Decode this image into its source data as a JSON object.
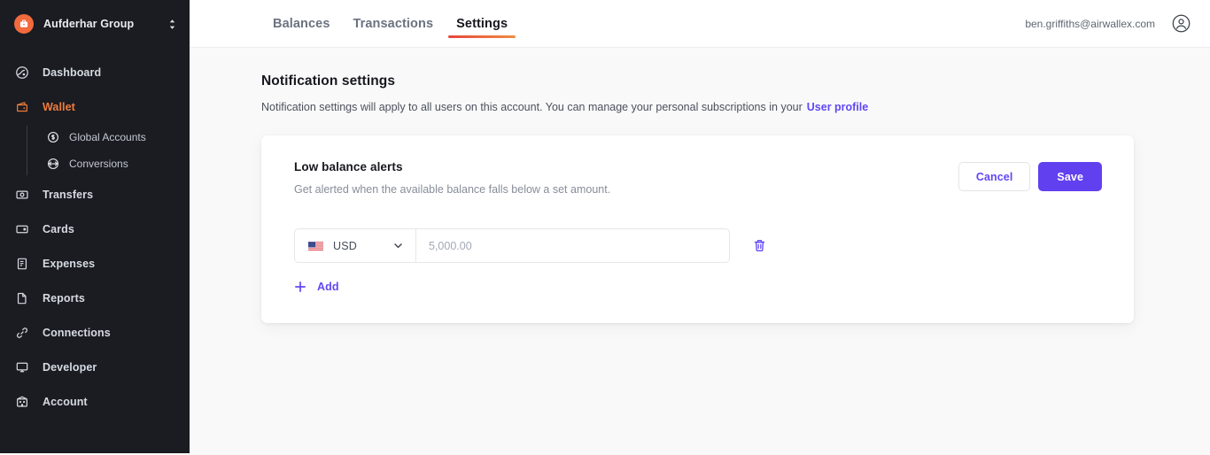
{
  "sidebar": {
    "org": {
      "name": "Aufderhar Group",
      "logo_icon": "briefcase-icon",
      "switch_icon": "chevron-up-down-icon",
      "logo_color": "#f26a3d"
    },
    "items": [
      {
        "label": "Dashboard",
        "icon": "dashboard-globe-icon",
        "active": false
      },
      {
        "label": "Wallet",
        "icon": "wallet-icon",
        "active": true
      },
      {
        "label": "Transfers",
        "icon": "transfers-icon",
        "active": false
      },
      {
        "label": "Cards",
        "icon": "card-icon",
        "active": false
      },
      {
        "label": "Expenses",
        "icon": "expenses-receipt-icon",
        "active": false
      },
      {
        "label": "Reports",
        "icon": "reports-document-icon",
        "active": false
      },
      {
        "label": "Connections",
        "icon": "link-icon",
        "active": false
      },
      {
        "label": "Developer",
        "icon": "monitor-icon",
        "active": false
      },
      {
        "label": "Account",
        "icon": "bank-building-icon",
        "active": false
      }
    ],
    "subitems": [
      {
        "label": "Global Accounts",
        "icon": "dollar-circle-icon"
      },
      {
        "label": "Conversions",
        "icon": "refresh-circle-icon"
      }
    ],
    "active_color": "#ef7c3c",
    "background": "#1a1c21"
  },
  "header": {
    "tabs": [
      {
        "label": "Balances",
        "active": false
      },
      {
        "label": "Transactions",
        "active": false
      },
      {
        "label": "Settings",
        "active": true
      }
    ],
    "user_email": "ben.griffiths@airwallex.com",
    "avatar_icon": "user-circle-icon",
    "active_tab_gradient_from": "#e5453c",
    "active_tab_gradient_to": "#ef8d44"
  },
  "page": {
    "title": "Notification settings",
    "description": "Notification settings will apply to all users on this account. You can manage your personal subscriptions in your",
    "link_label": "User profile",
    "link_color": "#6147f5"
  },
  "card": {
    "title": "Low balance alerts",
    "subtitle": "Get alerted when the available balance falls below a set amount.",
    "cancel_label": "Cancel",
    "save_label": "Save",
    "save_color": "#6140f0",
    "alert_rows": [
      {
        "currency_code": "USD",
        "flag_icon": "us-flag-icon",
        "chevron_icon": "chevron-down-icon",
        "amount_value": "",
        "amount_placeholder": "5,000.00",
        "delete_icon": "trash-icon"
      }
    ],
    "add_label": "Add",
    "add_icon": "plus-icon"
  }
}
